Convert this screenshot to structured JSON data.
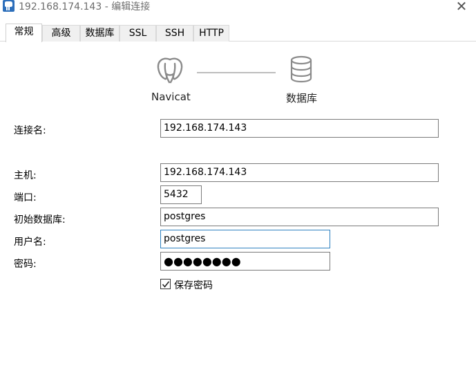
{
  "window": {
    "title": "192.168.174.143 - 编辑连接",
    "close_glyph": "✕"
  },
  "tabs": [
    {
      "label": "常规",
      "active": true
    },
    {
      "label": "高级",
      "active": false
    },
    {
      "label": "数据库",
      "active": false
    },
    {
      "label": "SSL",
      "active": false
    },
    {
      "label": "SSH",
      "active": false
    },
    {
      "label": "HTTP",
      "active": false
    }
  ],
  "flow": {
    "source_label": "Navicat",
    "source_icon": "postgresql-elephant-icon",
    "target_label": "数据库",
    "target_icon": "database-icon"
  },
  "form": {
    "connection_name_label": "连接名:",
    "connection_name_value": "192.168.174.143",
    "host_label": "主机:",
    "host_value": "192.168.174.143",
    "port_label": "端口:",
    "port_value": "5432",
    "initial_db_label": "初始数据库:",
    "initial_db_value": "postgres",
    "username_label": "用户名:",
    "username_value": "postgres",
    "password_label": "密码:",
    "password_value": "●●●●●●●●",
    "save_password_label": "保存密码",
    "save_password_checked": true
  },
  "colors": {
    "focus_border": "#2b7fbf",
    "icon_gray": "#8a8a8a",
    "app_icon_blue": "#2d6fbb"
  }
}
